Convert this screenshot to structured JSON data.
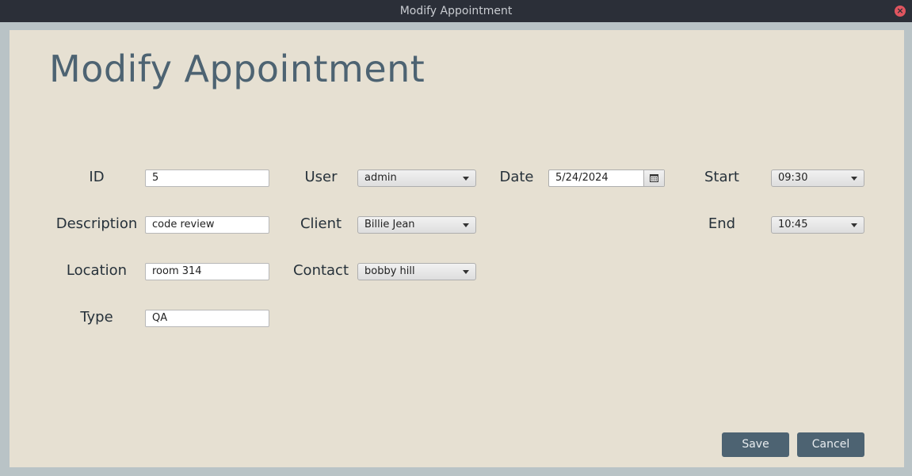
{
  "window": {
    "title": "Modify Appointment"
  },
  "page": {
    "title": "Modify Appointment"
  },
  "labels": {
    "id": "ID",
    "description": "Description",
    "location": "Location",
    "type": "Type",
    "user": "User",
    "client": "Client",
    "contact": "Contact",
    "date": "Date",
    "start": "Start",
    "end": "End"
  },
  "fields": {
    "id": "5",
    "description": "code review",
    "location": "room 314",
    "type": "QA",
    "user": "admin",
    "client": "Billie Jean",
    "contact": "bobby hill",
    "date": "5/24/2024",
    "start": "09:30",
    "end": "10:45"
  },
  "buttons": {
    "save": "Save",
    "cancel": "Cancel"
  },
  "icons": {
    "close": "close-icon",
    "calendar": "calendar-icon",
    "dropdown": "chevron-down-icon"
  },
  "colors": {
    "accent": "#4d6372",
    "panel": "#e6e0d2",
    "titlebar": "#2b2f38",
    "close": "#e0555f"
  }
}
